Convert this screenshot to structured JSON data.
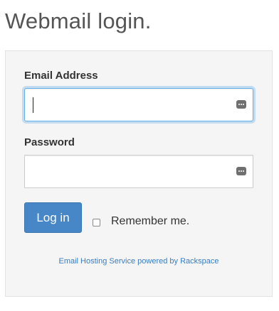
{
  "page": {
    "title": "Webmail login."
  },
  "form": {
    "email_label": "Email Address",
    "email_value": "",
    "password_label": "Password",
    "password_value": "",
    "login_button": "Log in",
    "remember_label": "Remember me.",
    "remember_checked": false
  },
  "footer": {
    "link_text": "Email Hosting Service powered by Rackspace"
  },
  "colors": {
    "button": "#4787c7",
    "focus_ring": "#66afe9",
    "link": "#3a7dc1",
    "panel_bg": "#f5f5f5"
  },
  "icons": [
    "password-manager-key-icon"
  ]
}
